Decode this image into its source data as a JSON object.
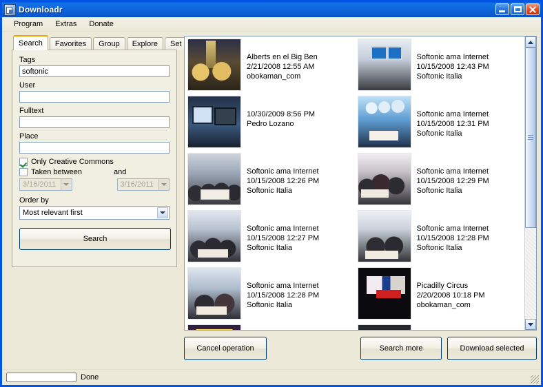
{
  "window": {
    "title": "Downloadr",
    "icon": "app-icon",
    "buttons": {
      "minimize": "minimize",
      "maximize": "maximize",
      "close": "close"
    }
  },
  "menubar": {
    "items": [
      "Program",
      "Extras",
      "Donate"
    ]
  },
  "tabs": {
    "items": [
      "Search",
      "Favorites",
      "Group",
      "Explore",
      "Set"
    ],
    "active": "Search"
  },
  "search_form": {
    "tags_label": "Tags",
    "tags_value": "softonic",
    "user_label": "User",
    "user_value": "",
    "fulltext_label": "Fulltext",
    "fulltext_value": "",
    "place_label": "Place",
    "place_value": "",
    "only_cc_label": "Only Creative Commons",
    "only_cc_checked": true,
    "taken_between_label": "Taken between",
    "taken_between_checked": false,
    "and_label": "and",
    "date_from": "3/16/2011",
    "date_to": "3/16/2011",
    "order_by_label": "Order by",
    "order_by_value": "Most relevant first",
    "search_button": "Search"
  },
  "results": {
    "left_column": [
      {
        "title": "Alberts en el Big Ben",
        "date": "2/21/2008 12:55 AM",
        "author": "obokaman_com",
        "thumb": "t1"
      },
      {
        "title": "",
        "date": "10/30/2009 8:56 PM",
        "author": "Pedro Lozano",
        "thumb": "t2"
      },
      {
        "title": "Softonic ama Internet",
        "date": "10/15/2008 12:26 PM",
        "author": "Softonic Italia",
        "thumb": "t3"
      },
      {
        "title": "Softonic ama Internet",
        "date": "10/15/2008 12:27 PM",
        "author": "Softonic Italia",
        "thumb": "t4"
      },
      {
        "title": "Softonic ama Internet",
        "date": "10/15/2008 12:28 PM",
        "author": "Softonic Italia",
        "thumb": "t5"
      },
      {
        "title": "",
        "date": "",
        "author": "",
        "thumb": "t6"
      }
    ],
    "right_column": [
      {
        "title": "Softonic ama Internet",
        "date": "10/15/2008 12:43 PM",
        "author": "Softonic Italia",
        "thumb": "t7"
      },
      {
        "title": "Softonic ama Internet",
        "date": "10/15/2008 12:31 PM",
        "author": "Softonic Italia",
        "thumb": "t8"
      },
      {
        "title": "Softonic ama Internet",
        "date": "10/15/2008 12:29 PM",
        "author": "Softonic Italia",
        "thumb": "t9"
      },
      {
        "title": "Softonic ama Internet",
        "date": "10/15/2008 12:28 PM",
        "author": "Softonic Italia",
        "thumb": "t10"
      },
      {
        "title": "Picadilly Circus",
        "date": "2/20/2008 10:18 PM",
        "author": "obokaman_com",
        "thumb": "t11"
      },
      {
        "title": "",
        "date": "",
        "author": "",
        "thumb": "t13"
      }
    ]
  },
  "actions": {
    "cancel": "Cancel operation",
    "search_more": "Search more",
    "download_selected": "Download selected"
  },
  "statusbar": {
    "progress_percent": 0,
    "text": "Done"
  },
  "colors": {
    "titlebar": "#0a5fd4",
    "window_face": "#ece9d8",
    "active_tab_accent": "#f0a000",
    "field_border": "#7f9db9",
    "button_border": "#003c74",
    "checkmark": "#2a8a2a"
  }
}
